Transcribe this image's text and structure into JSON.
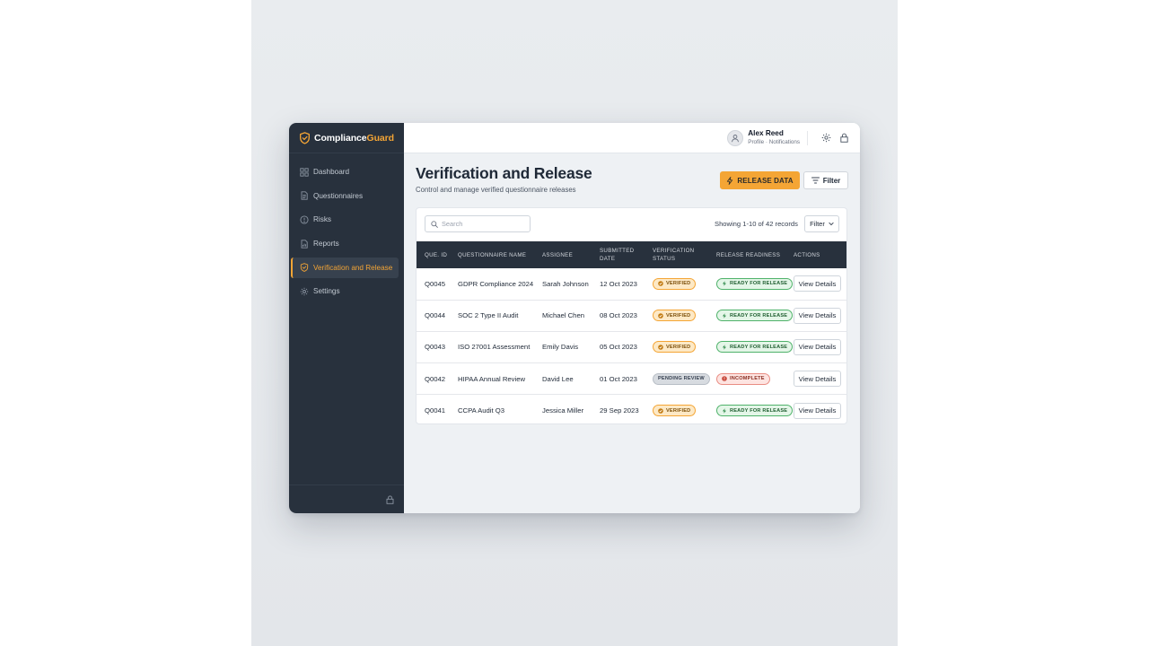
{
  "brand": {
    "name_main": "Compliance",
    "name_accent": "Guard",
    "accent_color": "#f4a535",
    "sidebar_color": "#28313d"
  },
  "sidebar": {
    "items": [
      {
        "label": "Dashboard",
        "icon": "grid-icon",
        "active": false
      },
      {
        "label": "Questionnaires",
        "icon": "document-icon",
        "active": false
      },
      {
        "label": "Risks",
        "icon": "alert-circle-icon",
        "active": false
      },
      {
        "label": "Reports",
        "icon": "report-icon",
        "active": false
      },
      {
        "label": "Verification and Release",
        "icon": "shield-check-icon",
        "active": true
      },
      {
        "label": "Settings",
        "icon": "gear-icon",
        "active": false
      }
    ],
    "footer_icon": "lock-icon"
  },
  "header": {
    "user_name": "Alex Reed",
    "user_links": "Profile · Notifications",
    "icons": [
      "gear-icon",
      "lock-icon"
    ]
  },
  "page": {
    "title": "Verification and Release",
    "subtitle": "Control and manage verified questionnaire releases",
    "release_button": "RELEASE DATA",
    "filter_button": "Filter"
  },
  "table": {
    "search_placeholder": "Search",
    "records_text": "Showing 1-10 of 42 records",
    "filter_select": "Filter",
    "columns": [
      "QUE. ID",
      "QUESTIONNAIRE NAME",
      "ASSIGNEE",
      "SUBMITTED DATE",
      "VERIFICATION STATUS",
      "RELEASE READINESS",
      "ACTIONS"
    ],
    "rows": [
      {
        "id": "Q0045",
        "name": "GDPR Compliance 2024",
        "assignee": "Sarah Johnson",
        "date": "12 Oct 2023",
        "verification": "VERIFIED",
        "readiness": "READY FOR RELEASE",
        "action": "View Details"
      },
      {
        "id": "Q0044",
        "name": "SOC 2 Type II Audit",
        "assignee": "Michael Chen",
        "date": "08 Oct 2023",
        "verification": "VERIFIED",
        "readiness": "READY FOR RELEASE",
        "action": "View Details"
      },
      {
        "id": "Q0043",
        "name": "ISO 27001 Assessment",
        "assignee": "Emily Davis",
        "date": "05 Oct 2023",
        "verification": "VERIFIED",
        "readiness": "READY FOR RELEASE",
        "action": "View Details"
      },
      {
        "id": "Q0042",
        "name": "HIPAA Annual Review",
        "assignee": "David Lee",
        "date": "01 Oct 2023",
        "verification": "PENDING REVIEW",
        "readiness": "INCOMPLETE",
        "action": "View Details"
      },
      {
        "id": "Q0041",
        "name": "CCPA Audit Q3",
        "assignee": "Jessica Miller",
        "date": "29 Sep 2023",
        "verification": "VERIFIED",
        "readiness": "READY FOR RELEASE",
        "action": "View Details"
      }
    ]
  }
}
